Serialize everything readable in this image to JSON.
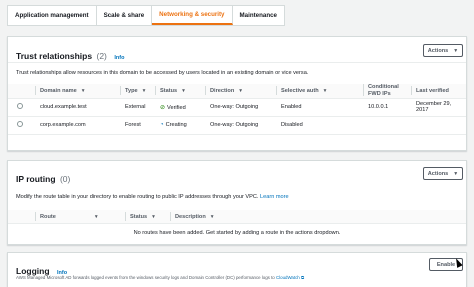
{
  "tabs": [
    {
      "label": "Application management"
    },
    {
      "label": "Scale & share"
    },
    {
      "label": "Networking & security"
    },
    {
      "label": "Maintenance"
    }
  ],
  "trust": {
    "title": "Trust relationships",
    "count": "(2)",
    "info": "Info",
    "actions": "Actions",
    "description": "Trust relationships allow resources in this domain to be accessed by users located in an existing domain or vice versa.",
    "headers": {
      "domain": "Domain name",
      "type": "Type",
      "status": "Status",
      "direction": "Direction",
      "selective": "Selective auth",
      "conditional": "Conditional FWD IPs",
      "verified": "Last verified"
    },
    "rows": [
      {
        "domain": "cloud.example.test",
        "type": "External",
        "status": "Verified",
        "direction": "One-way: Outgoing",
        "selective": "Enabled",
        "conditional": "10.0.0.1",
        "verified": "December 29, 2017"
      },
      {
        "domain": "corp.example.com",
        "type": "Forest",
        "status": "Creating",
        "direction": "One-way: Outgoing",
        "selective": "Disabled",
        "conditional": "",
        "verified": ""
      }
    ]
  },
  "routing": {
    "title": "IP routing",
    "count": "(0)",
    "actions": "Actions",
    "description": "Modify the route table in your directory to enable routing to public IP addresses through your VPC.",
    "learn_more": "Learn more",
    "headers": {
      "route": "Route",
      "status": "Status",
      "description": "Description"
    },
    "empty": "No routes have been added. Get started by adding a route in the actions dropdown."
  },
  "logging": {
    "title": "Logging",
    "info": "Info",
    "enable": "Enable",
    "description": "AWS Managed Microsoft AD forwards logged events from the windows security logs and Domain Controller (DC) performance logs to",
    "cloudwatch": "CloudWatch"
  },
  "colors": {
    "accent": "#ec7211",
    "link": "#0073bb",
    "success": "#1d8102"
  }
}
